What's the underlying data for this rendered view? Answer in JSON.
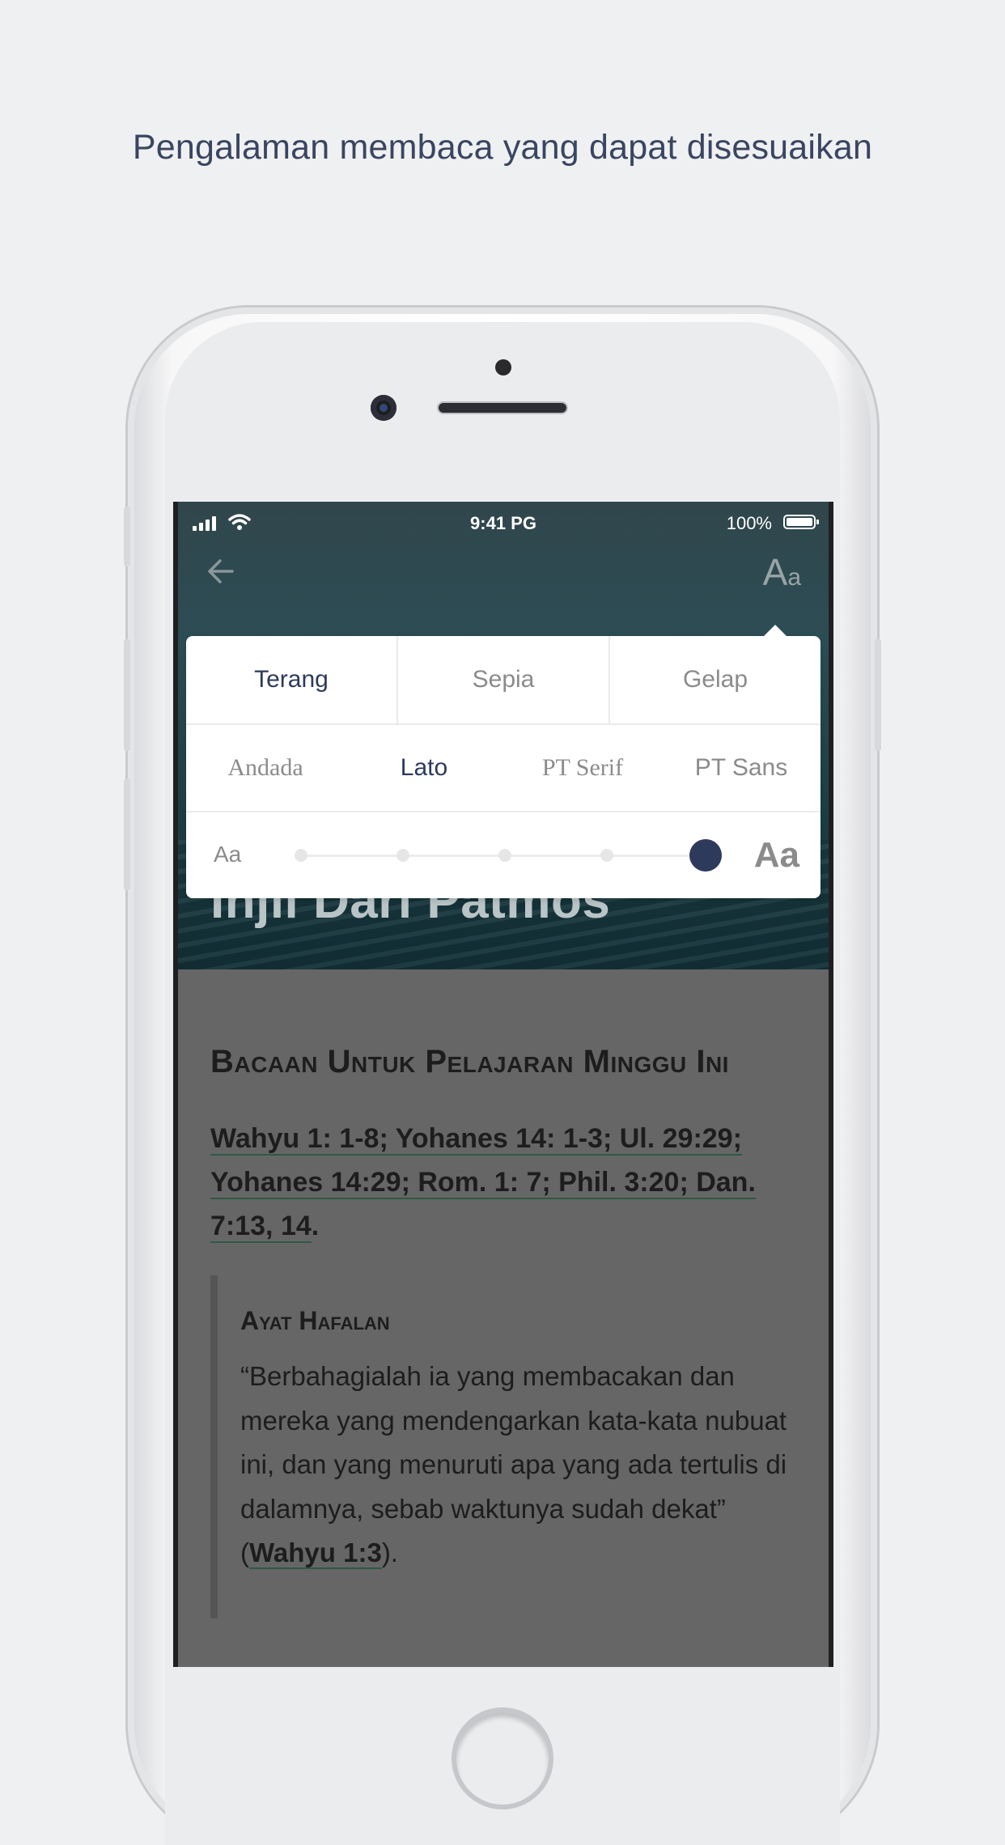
{
  "headline": "Pengalaman membaca yang dapat disesuaikan",
  "status_bar": {
    "time": "9:41 PG",
    "battery": "100%"
  },
  "toolbar": {
    "font_icon_big": "A",
    "font_icon_small": "a"
  },
  "hero": {
    "title": "Injil Dari Patmos"
  },
  "settings": {
    "themes": [
      {
        "label": "Terang",
        "active": true
      },
      {
        "label": "Sepia",
        "active": false
      },
      {
        "label": "Gelap",
        "active": false
      }
    ],
    "fonts": [
      {
        "label": "Andada",
        "active": false
      },
      {
        "label": "Lato",
        "active": true
      },
      {
        "label": "PT Serif",
        "active": false
      },
      {
        "label": "PT Sans",
        "active": false
      }
    ],
    "size_small_label": "Aa",
    "size_large_label": "Aa",
    "size_steps": 5,
    "size_selected_step": 5
  },
  "content": {
    "section_title": "Bacaan Untuk Pelajaran Minggu Ini",
    "refs": {
      "r1": "Wahyu 1: 1-8; Yohanes 14: 1-3; Ul. 29:29; Yohanes 14:29; Rom. 1: 7; Phil. 3:20; Dan. 7:13, 14",
      "end": "."
    },
    "memory_title": "Ayat Hafalan",
    "memory_text": "“Berbahagialah ia yang membacakan dan mereka yang mendengarkan kata-kata nubuat ini, dan yang menuruti apa yang ada tertulis di dalamnya, sebab waktunya sudah dekat” (",
    "memory_ref": "Wahyu 1:3",
    "memory_end": ")."
  },
  "colors": {
    "accent": "#2d3a5c",
    "inactive": "#8b8b8b",
    "background": "#eff0f2",
    "hero": "#2d4d55",
    "overlay": "#666667"
  }
}
